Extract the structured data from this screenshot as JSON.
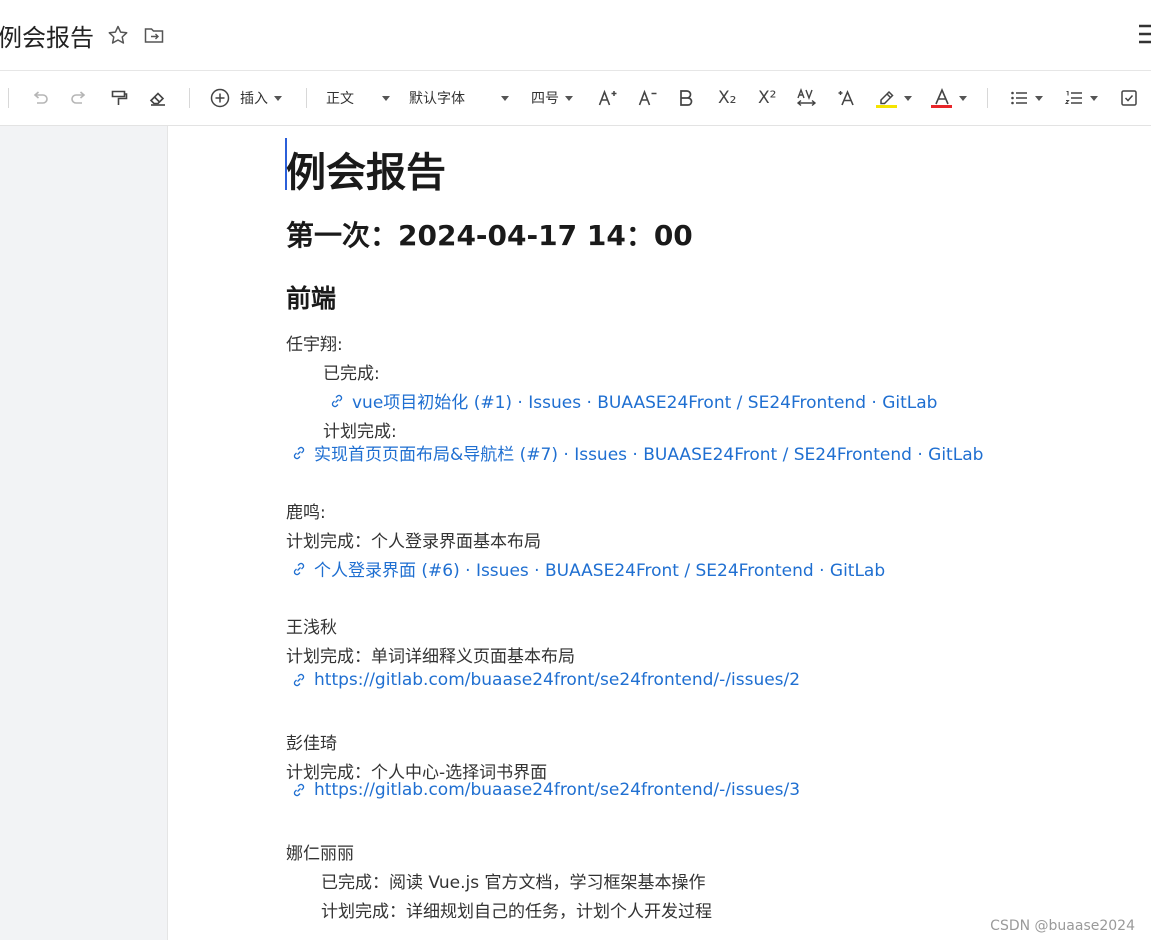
{
  "titlebar": {
    "doc_title": "例会报告"
  },
  "toolbar": {
    "insert_label": "插入",
    "style_value": "正文",
    "font_value": "默认字体",
    "size_value": "四号",
    "subscript_glyph": "X₂",
    "superscript_glyph": "X²",
    "highlight_color": "#f5e400",
    "font_color": "#e8262a"
  },
  "document": {
    "title": "例会报告",
    "meeting_heading": "第一次：2024-04-17 14：00",
    "section_heading": "前端",
    "members": [
      {
        "name": "任宇翔:",
        "done_label": "已完成:",
        "done_link": "vue项目初始化 (#1) · Issues · BUAASE24Front / SE24Frontend · GitLab",
        "plan_label": "计划完成:",
        "plan_link": "实现首页页面布局&导航栏 (#7) · Issues · BUAASE24Front / SE24Frontend · GitLab"
      },
      {
        "name": "鹿鸣:",
        "plan_text": "计划完成：个人登录界面基本布局",
        "plan_link": "个人登录界面 (#6) · Issues · BUAASE24Front / SE24Frontend · GitLab"
      },
      {
        "name": "王浅秋",
        "plan_text": "计划完成：单词详细释义页面基本布局",
        "plan_link": "https://gitlab.com/buaase24front/se24frontend/-/issues/2"
      },
      {
        "name": "彭佳琦",
        "plan_text": "计划完成：个人中心-选择词书界面",
        "plan_link": "https://gitlab.com/buaase24front/se24frontend/-/issues/3"
      },
      {
        "name": "娜仁丽丽",
        "done_text": "已完成：阅读 Vue.js 官方文档，学习框架基本操作",
        "plan_text": "计划完成：详细规划自己的任务，计划个人开发过程"
      }
    ]
  },
  "watermark": "CSDN @buaase2024"
}
